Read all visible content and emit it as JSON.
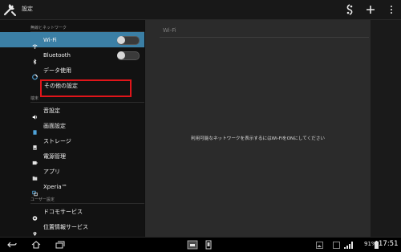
{
  "app": {
    "title": "設定"
  },
  "left": {
    "sections": [
      {
        "header": "無線とネットワーク",
        "items": [
          {
            "label": "Wi-Fi",
            "icon": "wifi-icon",
            "selected": true,
            "toggle": "off"
          },
          {
            "label": "Bluetooth",
            "icon": "bluetooth-icon",
            "toggle": "off"
          },
          {
            "label": "データ使用",
            "icon": "data-usage-icon"
          },
          {
            "label": "その他の設定"
          }
        ]
      },
      {
        "header": "端末",
        "items": [
          {
            "label": "音設定",
            "icon": "speaker-icon"
          },
          {
            "label": "画面設定",
            "icon": "display-icon"
          },
          {
            "label": "ストレージ",
            "icon": "storage-icon"
          },
          {
            "label": "電源管理",
            "icon": "battery-icon"
          },
          {
            "label": "アプリ",
            "icon": "apps-icon"
          },
          {
            "label": "Xperia™",
            "icon": "xperia-icon"
          }
        ]
      },
      {
        "header": "ユーザー設定",
        "items": [
          {
            "label": "ドコモサービス",
            "icon": "docomo-icon"
          },
          {
            "label": "位置情報サービス",
            "icon": "location-icon"
          }
        ]
      }
    ]
  },
  "right": {
    "title": "Wi-Fi",
    "message": "利用可能なネットワークを表示するにはWi-FiをONにしてください"
  },
  "status": {
    "battery": "91%",
    "time": "17:51"
  },
  "colors": {
    "selected": "#3b7fa5",
    "highlight_box": "#e0151a"
  }
}
